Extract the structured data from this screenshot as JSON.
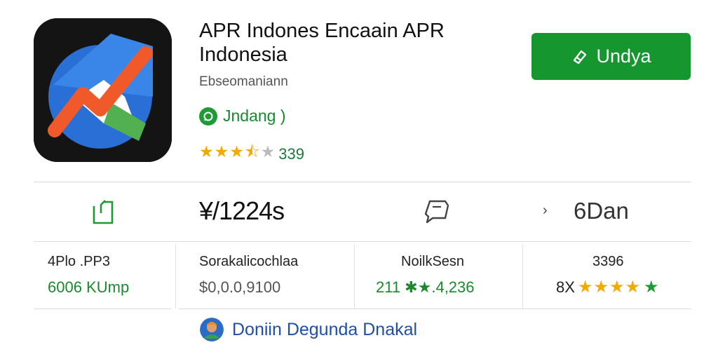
{
  "app": {
    "title_line1": "APR Indones Encaain APR",
    "title_line2": "Indonesia",
    "developer": "Ebseomaniann",
    "install_label": "Undya",
    "status_label": "Jndang )",
    "rating": {
      "stars": 3.5,
      "count": "339"
    }
  },
  "stats": {
    "primary_value": "¥/1224s",
    "days_value": "6Dan"
  },
  "details": [
    {
      "label": "4Plo .PP3",
      "value": "6006 KUmp"
    },
    {
      "label": "Sorakalicochlaa",
      "value": "$0,0.0,9100"
    },
    {
      "label": "NoilkSesn",
      "value": "211 ✱★.4,236"
    },
    {
      "label": "3396",
      "value_prefix": "8X",
      "stars": 5
    }
  ],
  "author": {
    "name": "Doniin Degunda Dnakal"
  },
  "colors": {
    "accent_green": "#16962f",
    "star": "#f2a900",
    "link_blue": "#1f4fa8"
  },
  "icons": [
    "app-logo-icon",
    "edit-icon",
    "whatsapp-icon",
    "share-icon",
    "chat-icon",
    "chevron-right-icon",
    "star-icon"
  ]
}
